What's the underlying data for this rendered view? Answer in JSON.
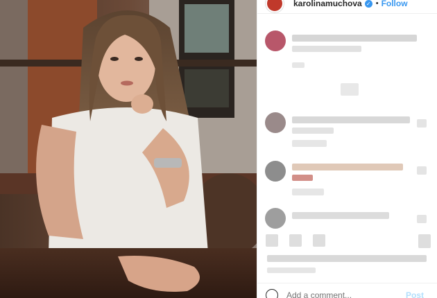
{
  "header": {
    "username": "karolinamuchova",
    "separator": "•",
    "follow_label": "Follow",
    "verified_icon": "verified-badge-icon"
  },
  "comment_box": {
    "placeholder": "Add a comment...",
    "post_label": "Post",
    "emoji_icon": "emoji-icon"
  },
  "colors": {
    "accent": "#3897f0",
    "post_disabled": "#b2dffc",
    "avatar": "#c0392b"
  }
}
